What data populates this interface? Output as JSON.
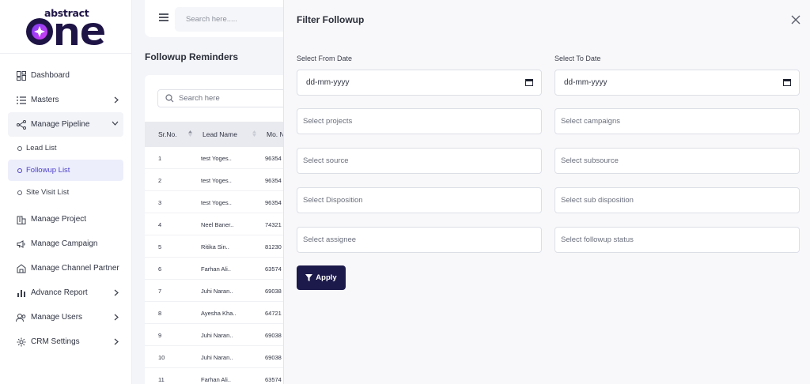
{
  "brand": {
    "top_word": "abstract",
    "main_word": "one"
  },
  "sidebar": {
    "items": [
      {
        "label": "Dashboard",
        "icon": "dashboard-icon"
      },
      {
        "label": "Masters",
        "icon": "list-icon"
      },
      {
        "label": "Manage Pipeline",
        "icon": "pipeline-icon"
      },
      {
        "label": "Manage Project",
        "icon": "building-icon"
      },
      {
        "label": "Manage Campaign",
        "icon": "megaphone-icon"
      },
      {
        "label": "Manage Channel Partner",
        "icon": "partner-icon"
      },
      {
        "label": "Advance Report",
        "icon": "bar-chart-icon"
      },
      {
        "label": "Manage Users",
        "icon": "users-icon"
      },
      {
        "label": "CRM Settings",
        "icon": "gear-icon"
      }
    ],
    "pipeline_sub": [
      {
        "label": "Lead List"
      },
      {
        "label": "Followup List"
      },
      {
        "label": "Site Visit List"
      }
    ]
  },
  "header": {
    "search_placeholder": "Search here....."
  },
  "page": {
    "title": "Followup Reminders",
    "search_placeholder": "Search here"
  },
  "table": {
    "headers": [
      "Sr.No.",
      "Lead Name",
      "Mo. N"
    ],
    "rows": [
      [
        "1",
        "test Yoges..",
        "96354"
      ],
      [
        "2",
        "test Yoges..",
        "96354"
      ],
      [
        "3",
        "test Yoges..",
        "96354"
      ],
      [
        "4",
        "Neel Baner..",
        "74321"
      ],
      [
        "5",
        "Ritika Sin..",
        "81230"
      ],
      [
        "6",
        "Farhan Ali..",
        "63574"
      ],
      [
        "7",
        "Juhi Naran..",
        "69038"
      ],
      [
        "8",
        "Ayesha Kha..",
        "64721"
      ],
      [
        "9",
        "Juhi Naran..",
        "69038"
      ],
      [
        "10",
        "Juhi Naran..",
        "69038"
      ],
      [
        "11",
        "Farhan Ali..",
        "63574"
      ]
    ]
  },
  "filter": {
    "title": "Filter Followup",
    "from_label": "Select From Date",
    "to_label": "Select To Date",
    "from_value": "dd-mm-yyyy",
    "to_value": "dd-mm-yyyy",
    "projects": "Select projects",
    "campaigns": "Select campaigns",
    "source": "Select source",
    "subsource": "Select subsource",
    "disposition": "Select Disposition",
    "sub_disposition": "Select sub disposition",
    "assignee": "Select assignee",
    "followup_status": "Select followup status",
    "apply_label": "Apply"
  },
  "colors": {
    "accent": "#4c3fc9",
    "apply_bg": "#1c1a4a",
    "panel_bg": "#f8f8fa"
  }
}
